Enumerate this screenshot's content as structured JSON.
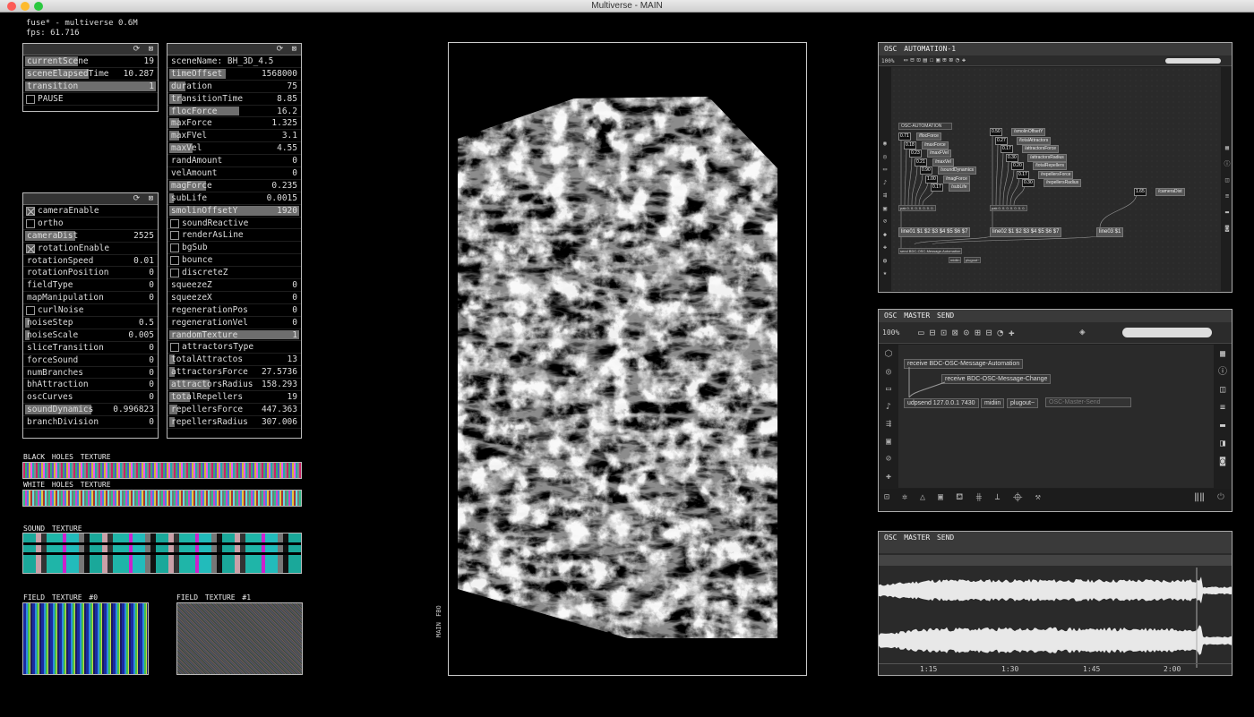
{
  "window": {
    "title": "Multiverse - MAIN"
  },
  "stats": {
    "line1": "fuse* - multiverse 0.6M",
    "line2": "fps: 61.716"
  },
  "panel_scene": {
    "icons": "⟳ ⊠",
    "rows": [
      {
        "label": "currentScene",
        "value": "19",
        "fill": 0.42
      },
      {
        "label": "sceneElapsedTime",
        "value": "10.287",
        "fill": 0.5
      },
      {
        "label": "transition",
        "value": "1",
        "fill": 1.0
      },
      {
        "label": "PAUSE",
        "value": "",
        "check": false
      }
    ]
  },
  "panel_camera": {
    "icons": "⟳ ⊠",
    "rows": [
      {
        "label": "cameraEnable",
        "value": "",
        "check": true
      },
      {
        "label": "ortho",
        "value": "",
        "check": false
      },
      {
        "label": "cameraDist",
        "value": "2525",
        "fill": 0.4
      },
      {
        "label": "rotationEnable",
        "value": "",
        "check": true
      },
      {
        "label": "rotationSpeed",
        "value": "0.01",
        "fill": 0.02
      },
      {
        "label": "rotationPosition",
        "value": "0",
        "fill": 0
      },
      {
        "label": "fieldType",
        "value": "0",
        "fill": 0
      },
      {
        "label": "mapManipulation",
        "value": "0",
        "fill": 0
      },
      {
        "label": "curlNoise",
        "value": "",
        "check": false
      },
      {
        "label": "noiseStep",
        "value": "0.5",
        "fill": 0.06
      },
      {
        "label": "noiseScale",
        "value": "0.005",
        "fill": 0.06
      },
      {
        "label": "sliceTransition",
        "value": "0",
        "fill": 0
      },
      {
        "label": "forceSound",
        "value": "0",
        "fill": 0
      },
      {
        "label": "numBranches",
        "value": "0",
        "fill": 0
      },
      {
        "label": "bhAttraction",
        "value": "0",
        "fill": 0
      },
      {
        "label": "oscCurves",
        "value": "0",
        "fill": 0
      },
      {
        "label": "soundDynamics",
        "value": "0.996823",
        "fill": 0.52
      },
      {
        "label": "branchDivision",
        "value": "0",
        "fill": 0
      }
    ]
  },
  "panel_params": {
    "icons": "⟳ ⊠",
    "rows": [
      {
        "label": "sceneName: BH_3D_4.5",
        "value": "",
        "fill": 0
      },
      {
        "label": "timeOffset",
        "value": "1568000",
        "fill": 0.45
      },
      {
        "label": "duration",
        "value": "75",
        "fill": 0.15
      },
      {
        "label": "transitionTime",
        "value": "8.85",
        "fill": 0.12
      },
      {
        "label": "flocForce",
        "value": "16.2",
        "fill": 0.55
      },
      {
        "label": "maxForce",
        "value": "1.325",
        "fill": 0.1
      },
      {
        "label": "maxFVel",
        "value": "3.1",
        "fill": 0.1
      },
      {
        "label": "maxVel",
        "value": "4.55",
        "fill": 0.2
      },
      {
        "label": "randAmount",
        "value": "0",
        "fill": 0
      },
      {
        "label": "velAmount",
        "value": "0",
        "fill": 0
      },
      {
        "label": "magForce",
        "value": "0.235",
        "fill": 0.3
      },
      {
        "label": "subLife",
        "value": "0.0015",
        "fill": 0.06
      },
      {
        "label": "smolinOffsetY",
        "value": "1920",
        "fill": 1.0
      },
      {
        "label": "soundReactive",
        "value": "",
        "check": false
      },
      {
        "label": "renderAsLine",
        "value": "",
        "check": false
      },
      {
        "label": "bgSub",
        "value": "",
        "check": false
      },
      {
        "label": "bounce",
        "value": "",
        "check": false
      },
      {
        "label": "discreteZ",
        "value": "",
        "check": false
      },
      {
        "label": "squeezeZ",
        "value": "0",
        "fill": 0
      },
      {
        "label": "squeezeX",
        "value": "0",
        "fill": 0
      },
      {
        "label": "regenerationPos",
        "value": "0",
        "fill": 0
      },
      {
        "label": "regenerationVel",
        "value": "0",
        "fill": 0
      },
      {
        "label": "randomTexture",
        "value": "1",
        "fill": 1.0
      },
      {
        "label": "attractorsType",
        "value": "",
        "check": false
      },
      {
        "label": "totalAttractos",
        "value": "13",
        "fill": 0.07
      },
      {
        "label": "attractorsForce",
        "value": "27.5736",
        "fill": 0.07
      },
      {
        "label": "attractorsRadius",
        "value": "158.293",
        "fill": 0.33
      },
      {
        "label": "totalRepellers",
        "value": "19",
        "fill": 0.18
      },
      {
        "label": "repellersForce",
        "value": "447.363",
        "fill": 0.09
      },
      {
        "label": "repellersRadius",
        "value": "307.006",
        "fill": 0.07
      }
    ]
  },
  "textures": {
    "black_holes": "BLACK HOLES TEXTURE",
    "white_holes": "WHITE HOLES TEXTURE",
    "sound": "SOUND TEXTURE",
    "field0": "FIELD TEXTURE #0",
    "field1": "FIELD TEXTURE #1"
  },
  "fbo": {
    "label": "MAIN FBO"
  },
  "osc_automation": {
    "title": "OSC AUTOMATION-1",
    "zoom": "100%",
    "header_obj": "OSC-AUTOMATION",
    "col1": [
      {
        "num": "0.71",
        "msg": "/flocForce"
      },
      {
        "num": "0.18",
        "msg": "/maxForce"
      },
      {
        "num": "0.23",
        "msg": "/maxFVel"
      },
      {
        "num": "0.21",
        "msg": "/maxVel"
      },
      {
        "num": "0.90",
        "msg": "/soundDynamics"
      },
      {
        "num": "1.00",
        "msg": "/magForce"
      },
      {
        "num": "0.17",
        "msg": "/subLife"
      }
    ],
    "col2": [
      {
        "num": "0.50",
        "msg": "/smolinOffsetY"
      },
      {
        "num": "0.27",
        "msg": "/totalAttractors"
      },
      {
        "num": "0.17",
        "msg": "/attractorsForce"
      },
      {
        "num": "0.30",
        "msg": "/attractorsRadius"
      },
      {
        "num": "0.20",
        "msg": "/totalRepellers"
      },
      {
        "num": "0.17",
        "msg": "/repellersForce"
      },
      {
        "num": "0.30",
        "msg": "/repellersRadius"
      }
    ],
    "col3": {
      "num": "1.65",
      "msg": "/cameraDist"
    },
    "pak1": "pak 0. 0. 0. 0. 0. 0. 0.",
    "pak2": "pak 0. 0. 0. 0. 0. 0. 0.",
    "line1": "line01 $1 $2 $3 $4 $5 $6 $7",
    "line2": "line02 $1 $2 $3 $4 $5 $6 $7",
    "line3": "line03 $1",
    "send": "send BDC-OSC-Message-Automation",
    "midiin": "midiin",
    "plugout": "plugout~"
  },
  "osc_master": {
    "title": "OSC MASTER SEND",
    "zoom": "100%",
    "receive1": "receive BDC-OSC-Message-Automation",
    "receive2": "receive BDC-OSC-Message-Change",
    "udpsend": "udpsend 127.0.0.1 7430",
    "midiin": "midiin",
    "plugout": "plugout~",
    "comment": "OSC-Master-Send"
  },
  "osc_audio": {
    "title": "OSC MASTER SEND",
    "times": [
      "1:15",
      "1:30",
      "1:45",
      "2:00"
    ]
  },
  "colors": {
    "bg": "#000000",
    "bar": "#6e6e6e",
    "panel_head": "#333333",
    "max_bg": "#1e1e1e",
    "waveform": "#e8e8e8"
  }
}
